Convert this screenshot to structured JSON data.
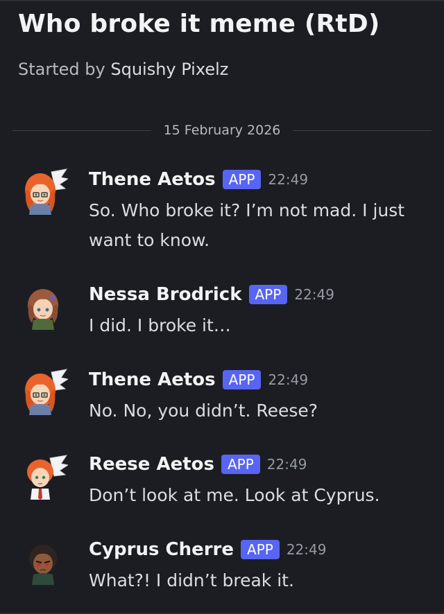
{
  "thread": {
    "title": "Who broke it meme (RtD)",
    "started_by_prefix": "Started by",
    "started_by_name": "Squishy Pixelz"
  },
  "date_divider": "15 February 2026",
  "badge_label": "APP",
  "messages": [
    {
      "username": "Thene Aetos",
      "timestamp": "22:49",
      "text": "So. Who broke it? I’m not mad. I just want to know.",
      "avatar_icon": "winged-redhead-avatar-icon"
    },
    {
      "username": "Nessa Brodrick",
      "timestamp": "22:49",
      "text": "I did. I broke it…",
      "avatar_icon": "brunette-avatar-icon"
    },
    {
      "username": "Thene Aetos",
      "timestamp": "22:49",
      "text": "No. No, you didn’t. Reese?",
      "avatar_icon": "winged-redhead-avatar-icon"
    },
    {
      "username": "Reese Aetos",
      "timestamp": "22:49",
      "text": "Don’t look at me. Look at Cyprus.",
      "avatar_icon": "winged-redhead-boy-avatar-icon"
    },
    {
      "username": "Cyprus Cherre",
      "timestamp": "22:49",
      "text": "What?! I didn’t break it.",
      "avatar_icon": "dark-haired-avatar-icon"
    }
  ],
  "colors": {
    "background": "#1c1d22",
    "badge": "#5865f2",
    "muted_text": "#b5bac1",
    "timestamp": "#949ba4"
  }
}
